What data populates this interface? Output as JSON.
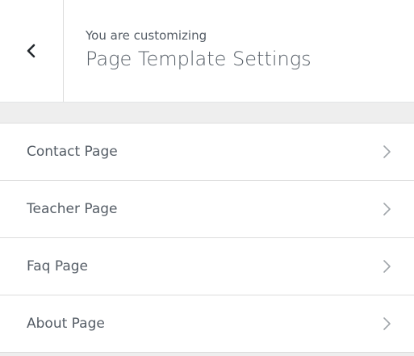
{
  "header": {
    "preamble": "You are customizing",
    "title": "Page Template Settings",
    "back_icon": "chevron-left-icon"
  },
  "menu": {
    "items": [
      {
        "label": "Contact Page",
        "icon": "chevron-right-icon"
      },
      {
        "label": "Teacher Page",
        "icon": "chevron-right-icon"
      },
      {
        "label": "Faq Page",
        "icon": "chevron-right-icon"
      },
      {
        "label": "About Page",
        "icon": "chevron-right-icon"
      }
    ]
  },
  "colors": {
    "text": "#555d66",
    "background": "#eeeeee",
    "panel": "#ffffff",
    "divider": "#dddddd",
    "chevron": "#a0a5aa"
  }
}
